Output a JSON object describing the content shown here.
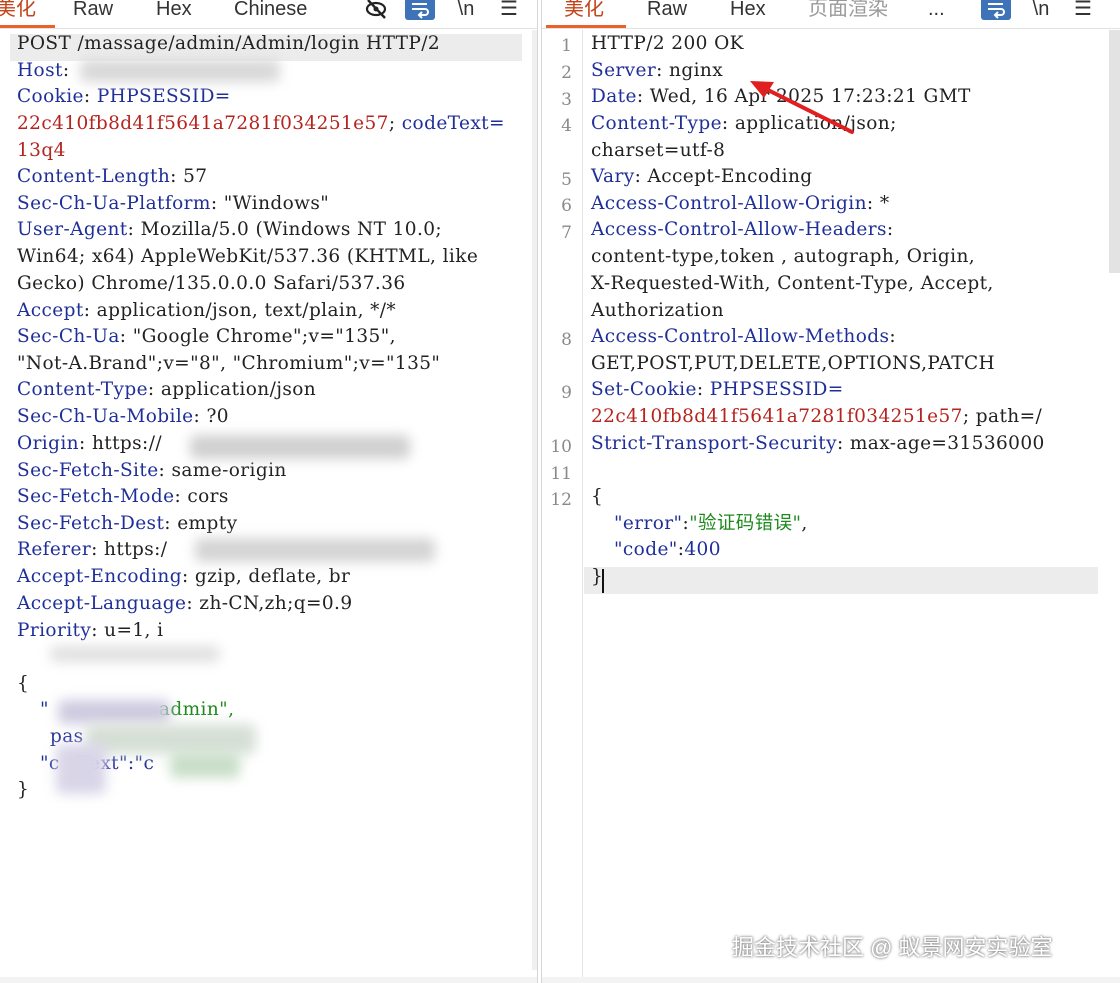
{
  "request": {
    "tabs": [
      {
        "label": "美化",
        "active": true
      },
      {
        "label": "Raw",
        "active": false
      },
      {
        "label": "Hex",
        "active": false
      },
      {
        "label": "Chinese",
        "active": false
      }
    ],
    "toolbar": {
      "eye_icon": "eye-slash-icon",
      "wrap_icon": "wrap-icon",
      "newline_label": "\\n",
      "menu_icon": "hamburger-icon"
    },
    "lines": {
      "l1": "POST /massage/admin/Admin/login HTTP/2",
      "l2k": "Host",
      "l3k": "Cookie",
      "l3v": "PHPSESSID=",
      "l4r": "22c410fb8d41f5641a7281f034251e57",
      "l4p": "; ",
      "l4k": "codeText",
      "l4e": "=",
      "l5r": "13q4",
      "l6k": "Content-Length",
      "l6v": "57",
      "l7k": "Sec-Ch-Ua-Platform",
      "l7v": "\"Windows\"",
      "l8k": "User-Agent",
      "l8v": "Mozilla/5.0 (Windows NT 10.0;",
      "l9v": "Win64; x64) AppleWebKit/537.36 (KHTML, like",
      "l10v": "Gecko) Chrome/135.0.0.0 Safari/537.36",
      "l11k": "Accept",
      "l11v": "application/json, text/plain, */*",
      "l12k": "Sec-Ch-Ua",
      "l12v": "\"Google Chrome\";v=\"135\",",
      "l13v": "\"Not-A.Brand\";v=\"8\", \"Chromium\";v=\"135\"",
      "l14k": "Content-Type",
      "l14v": "application/json",
      "l15k": "Sec-Ch-Ua-Mobile",
      "l15v": "?0",
      "l16k": "Origin",
      "l16v": "https://",
      "l17k": "Sec-Fetch-Site",
      "l17v": "same-origin",
      "l18k": "Sec-Fetch-Mode",
      "l18v": "cors",
      "l19k": "Sec-Fetch-Dest",
      "l19v": "empty",
      "l20k": "Referer",
      "l20v": "https:/",
      "l21k": "Accept-Encoding",
      "l21v": "gzip, deflate, br",
      "l22k": "Accept-Language",
      "l22v": "zh-CN,zh;q=0.9",
      "l23k": "Priority",
      "l23v": "u=1, i",
      "b1": "{",
      "b2a": "\"",
      "b2b": "admin\",",
      "b3": "pas",
      "b4a": "\"c",
      "b4b": "Text\":\"c",
      "b5": "}"
    }
  },
  "response": {
    "tabs": [
      {
        "label": "美化",
        "active": true
      },
      {
        "label": "Raw",
        "active": false
      },
      {
        "label": "Hex",
        "active": false
      },
      {
        "label": "页面渲染",
        "active": false
      },
      {
        "label": "...",
        "active": false
      }
    ],
    "toolbar": {
      "wrap_icon": "wrap-icon",
      "newline_label": "\\n",
      "menu_icon": "hamburger-icon"
    },
    "line_numbers": [
      "1",
      "2",
      "3",
      "4",
      "5",
      "6",
      "7",
      "8",
      "9",
      "10",
      "11",
      "12"
    ],
    "lines": {
      "r1": "HTTP/2 200 OK",
      "r2k": "Server",
      "r2v": "nginx",
      "r3k": "Date",
      "r3v": "Wed, 16 Apr 2025 17:23:21 GMT",
      "r4k": "Content-Type",
      "r4v": "application/json;",
      "r4c": "charset=utf-8",
      "r5k": "Vary",
      "r5v": "Accept-Encoding",
      "r6k": "Access-Control-Allow-Origin",
      "r6v": "*",
      "r7k": "Access-Control-Allow-Headers",
      "r7a": "content-type,token , autograph, Origin,",
      "r7b": "X-Requested-With, Content-Type, Accept,",
      "r7c": "Authorization",
      "r8k": "Access-Control-Allow-Methods",
      "r8a": "GET,POST,PUT,DELETE,OPTIONS,PATCH",
      "r9k": "Set-Cookie",
      "r9v": "PHPSESSID=",
      "r9r": "22c410fb8d41f5641a7281f034251e57",
      "r9t": "; path=/",
      "r10k": "Strict-Transport-Security",
      "r10v": "max-age=31536000",
      "r12": "{",
      "j1k": "\"error\"",
      "j1v": "\"验证码错误\"",
      "j2k": "\"code\"",
      "j2v": "400",
      "j3": "}"
    }
  },
  "watermark": "掘金技术社区 @ 蚁景网安实验室",
  "colors": {
    "key": "#1f2f99",
    "string_red": "#b5241e",
    "json_green": "#1c8a1c",
    "active_tab": "#c4451a",
    "arrow": "#e02020"
  }
}
